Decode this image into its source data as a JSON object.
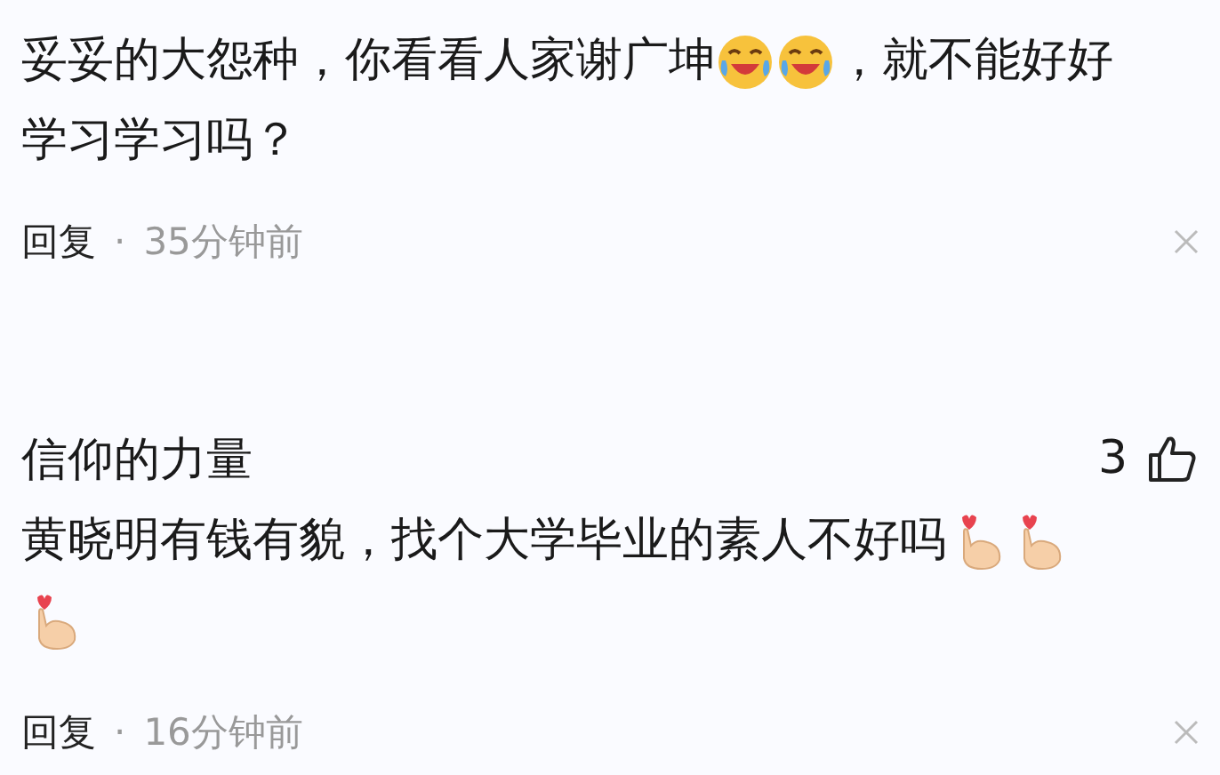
{
  "comments": [
    {
      "lines": [
        [
          {
            "kind": "text",
            "text": "妥妥的大怨种，你看看人家谢广坤"
          },
          {
            "kind": "laugh"
          },
          {
            "kind": "laugh"
          },
          {
            "kind": "text",
            "text": "，就不能好好"
          }
        ],
        [
          {
            "kind": "text",
            "text": "学习学习吗？"
          }
        ]
      ],
      "reply": "回复",
      "separator": "·",
      "time": "35分钟前"
    },
    {
      "author": "信仰的力量",
      "likes": "3",
      "lines": [
        [
          {
            "kind": "text",
            "text": "黄晓明有钱有貌，找个大学毕业的素人不好吗"
          },
          {
            "kind": "finger-heart"
          },
          {
            "kind": "finger-heart"
          }
        ],
        [
          {
            "kind": "finger-heart"
          }
        ]
      ],
      "reply": "回复",
      "separator": "·",
      "time": "16分钟前"
    }
  ]
}
